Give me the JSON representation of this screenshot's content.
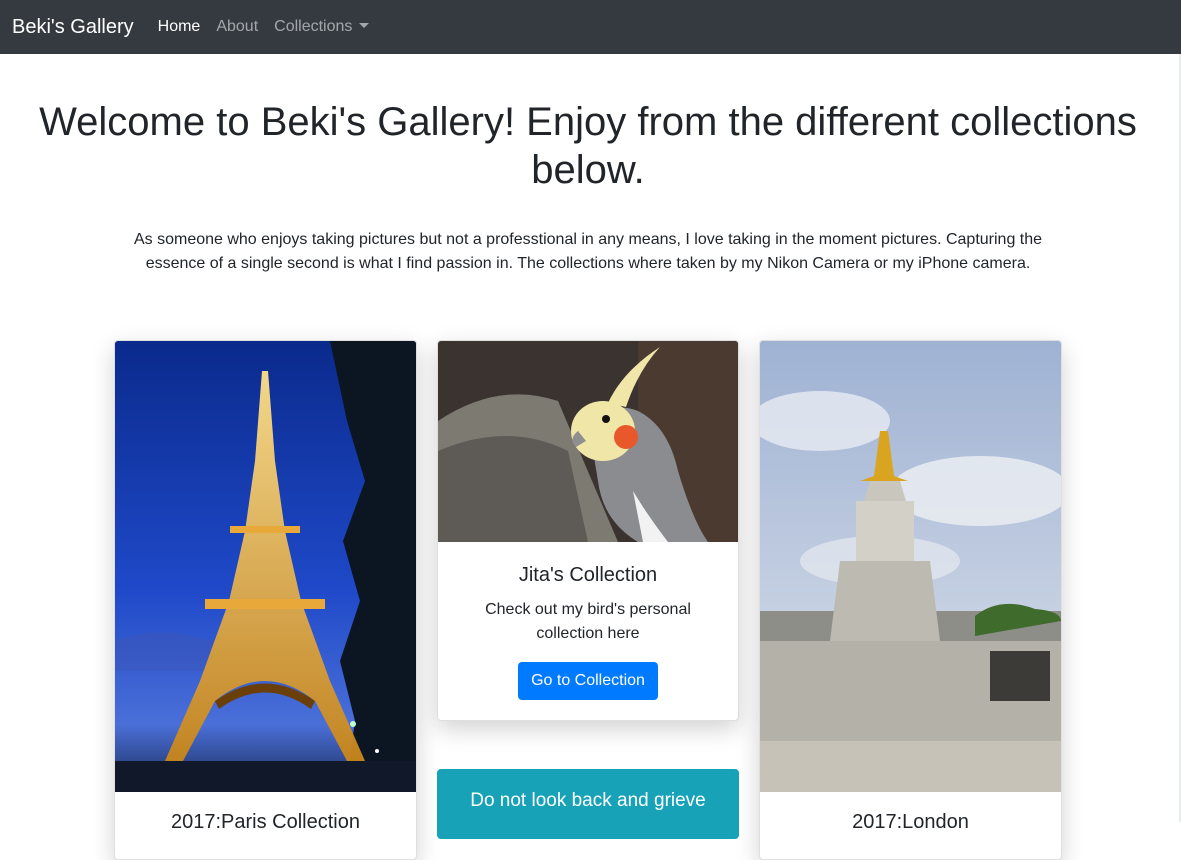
{
  "navbar": {
    "brand": "Beki's Gallery",
    "links": [
      {
        "label": "Home"
      },
      {
        "label": "About"
      },
      {
        "label": "Collections"
      }
    ]
  },
  "hero": {
    "title": "Welcome to Beki's Gallery! Enjoy from the different collections below.",
    "description": "As someone who enjoys taking pictures but not a professtional in any means, I love taking in the moment pictures. Capturing the essence of a single second is what I find passion in. The collections where taken by my Nikon Camera or my iPhone camera."
  },
  "cards": [
    {
      "image": "eiffel-tower-night-photo",
      "title": "2017:Paris Collection"
    },
    {
      "image": "cockatiel-bird-photo",
      "title": "Jita's Collection",
      "text": "Check out my bird's personal collection here",
      "button": "Go to Collection"
    },
    {
      "image": "victoria-memorial-london-photo",
      "title": "2017:London"
    }
  ],
  "quote_card": {
    "text": "Do not look back and grieve"
  },
  "colors": {
    "navbar": "#343a40",
    "primary": "#007bff",
    "info": "#17a2b8"
  }
}
